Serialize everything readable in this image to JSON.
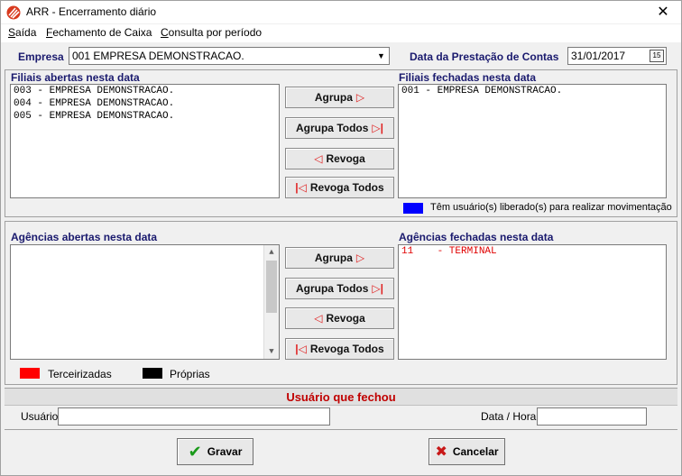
{
  "window": {
    "title": "ARR - Encerramento diário",
    "close_glyph": "✕"
  },
  "menu": [
    {
      "label": "Saída",
      "underline": "S"
    },
    {
      "label": "Fechamento de Caixa",
      "underline": "F"
    },
    {
      "label": "Consulta por período",
      "underline": "C"
    }
  ],
  "empresa": {
    "label": "Empresa",
    "value": "001 EMPRESA DEMONSTRACAO."
  },
  "data_prestacao": {
    "label": "Data da Prestação de Contas",
    "value": "31/01/2017",
    "button_glyph": "15"
  },
  "filiais": {
    "abertas_title": "Filiais abertas nesta data",
    "fechadas_title": "Filiais fechadas nesta data",
    "abertas": [
      "003 - EMPRESA DEMONSTRACAO.",
      "004 - EMPRESA DEMONSTRACAO.",
      "005 - EMPRESA DEMONSTRACAO."
    ],
    "fechadas": [
      "001 - EMPRESA DEMONSTRACAO."
    ],
    "legend": "Têm usuário(s) liberado(s) para realizar movimentação",
    "legend_color": "#0000ff"
  },
  "buttons": {
    "agrupa": "Agrupa",
    "agrupa_todos": "Agrupa Todos",
    "revoga": "Revoga",
    "revoga_todos": "Revoga Todos"
  },
  "agencias": {
    "abertas_title": "Agências abertas nesta data",
    "fechadas_title": "Agências fechadas nesta data",
    "abertas": [],
    "fechadas": [
      "11    - TERMINAL"
    ]
  },
  "legend_colors": {
    "terceirizadas_label": "Terceirizadas",
    "terceirizadas_color": "#ff0000",
    "proprias_label": "Próprias",
    "proprias_color": "#000000"
  },
  "usuario_fechou": {
    "title": "Usuário que fechou",
    "usuario_label": "Usuário",
    "usuario_value": "",
    "datahora_label": "Data / Hora",
    "datahora_value": ""
  },
  "actions": {
    "gravar": "Gravar",
    "cancelar": "Cancelar"
  }
}
